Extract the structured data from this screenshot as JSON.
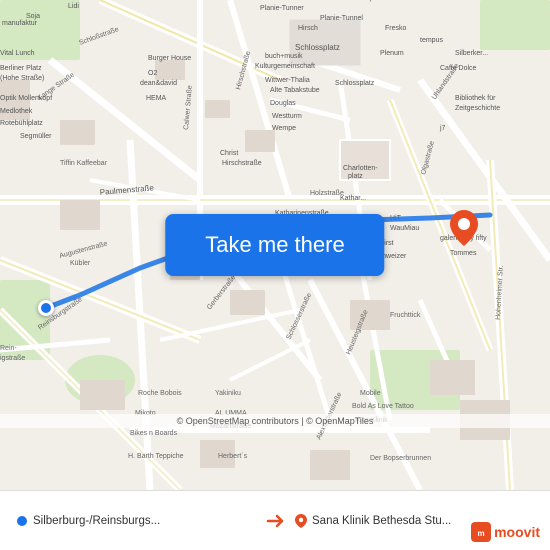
{
  "map": {
    "attribution": "© OpenStreetMap contributors | © OpenMapTiles",
    "button_label": "Take me there",
    "origin_marker_color": "#1a73e8",
    "dest_marker_color": "#e84c22"
  },
  "bottom_bar": {
    "from_label": "Silberburg-/Reinsburgs...",
    "to_label": "Sana Klinik Bethesda Stu...",
    "arrow_title": "arrow-right"
  },
  "moovit": {
    "logo_text": "moovit"
  }
}
